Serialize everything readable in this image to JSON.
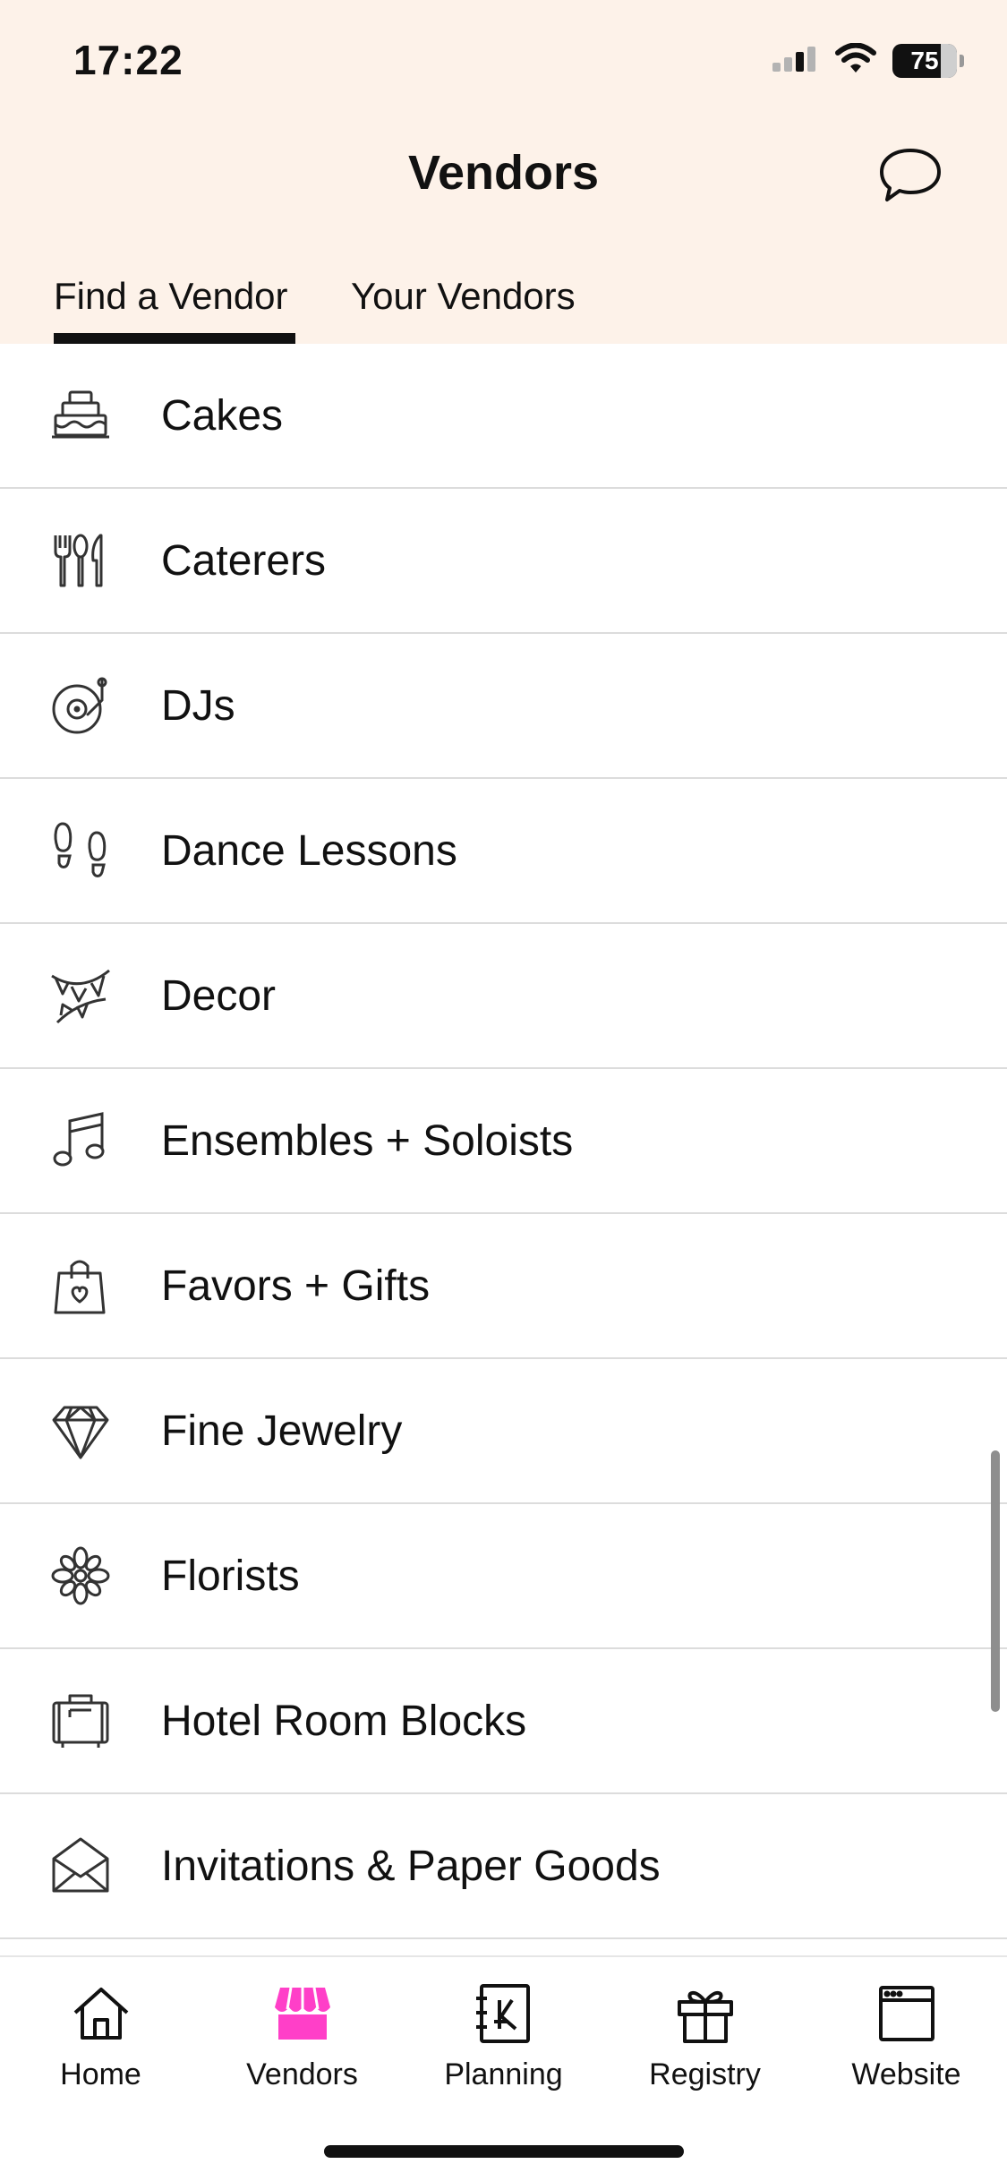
{
  "status_bar": {
    "time": "17:22",
    "battery": "75"
  },
  "header": {
    "title": "Vendors"
  },
  "tabs": [
    {
      "label": "Find a Vendor",
      "active": true
    },
    {
      "label": "Your Vendors",
      "active": false
    }
  ],
  "categories": [
    {
      "label": "Cakes",
      "icon": "cake-icon"
    },
    {
      "label": "Caterers",
      "icon": "utensils-icon"
    },
    {
      "label": "DJs",
      "icon": "record-player-icon"
    },
    {
      "label": "Dance Lessons",
      "icon": "footprints-icon"
    },
    {
      "label": "Decor",
      "icon": "bunting-icon"
    },
    {
      "label": "Ensembles + Soloists",
      "icon": "music-note-icon"
    },
    {
      "label": "Favors + Gifts",
      "icon": "gift-bag-icon"
    },
    {
      "label": "Fine Jewelry",
      "icon": "diamond-icon"
    },
    {
      "label": "Florists",
      "icon": "flower-icon"
    },
    {
      "label": "Hotel Room Blocks",
      "icon": "suitcase-icon"
    },
    {
      "label": "Invitations & Paper Goods",
      "icon": "envelope-icon"
    }
  ],
  "bottom_nav": [
    {
      "label": "Home",
      "icon": "home-icon",
      "active": false
    },
    {
      "label": "Vendors",
      "icon": "storefront-icon",
      "active": true
    },
    {
      "label": "Planning",
      "icon": "planner-icon",
      "active": false
    },
    {
      "label": "Registry",
      "icon": "gift-icon",
      "active": false
    },
    {
      "label": "Website",
      "icon": "browser-window-icon",
      "active": false
    }
  ],
  "colors": {
    "header_bg": "#fdf2e9",
    "accent": "#ff3fc8",
    "text": "#111111",
    "divider": "#dcdcdc"
  }
}
